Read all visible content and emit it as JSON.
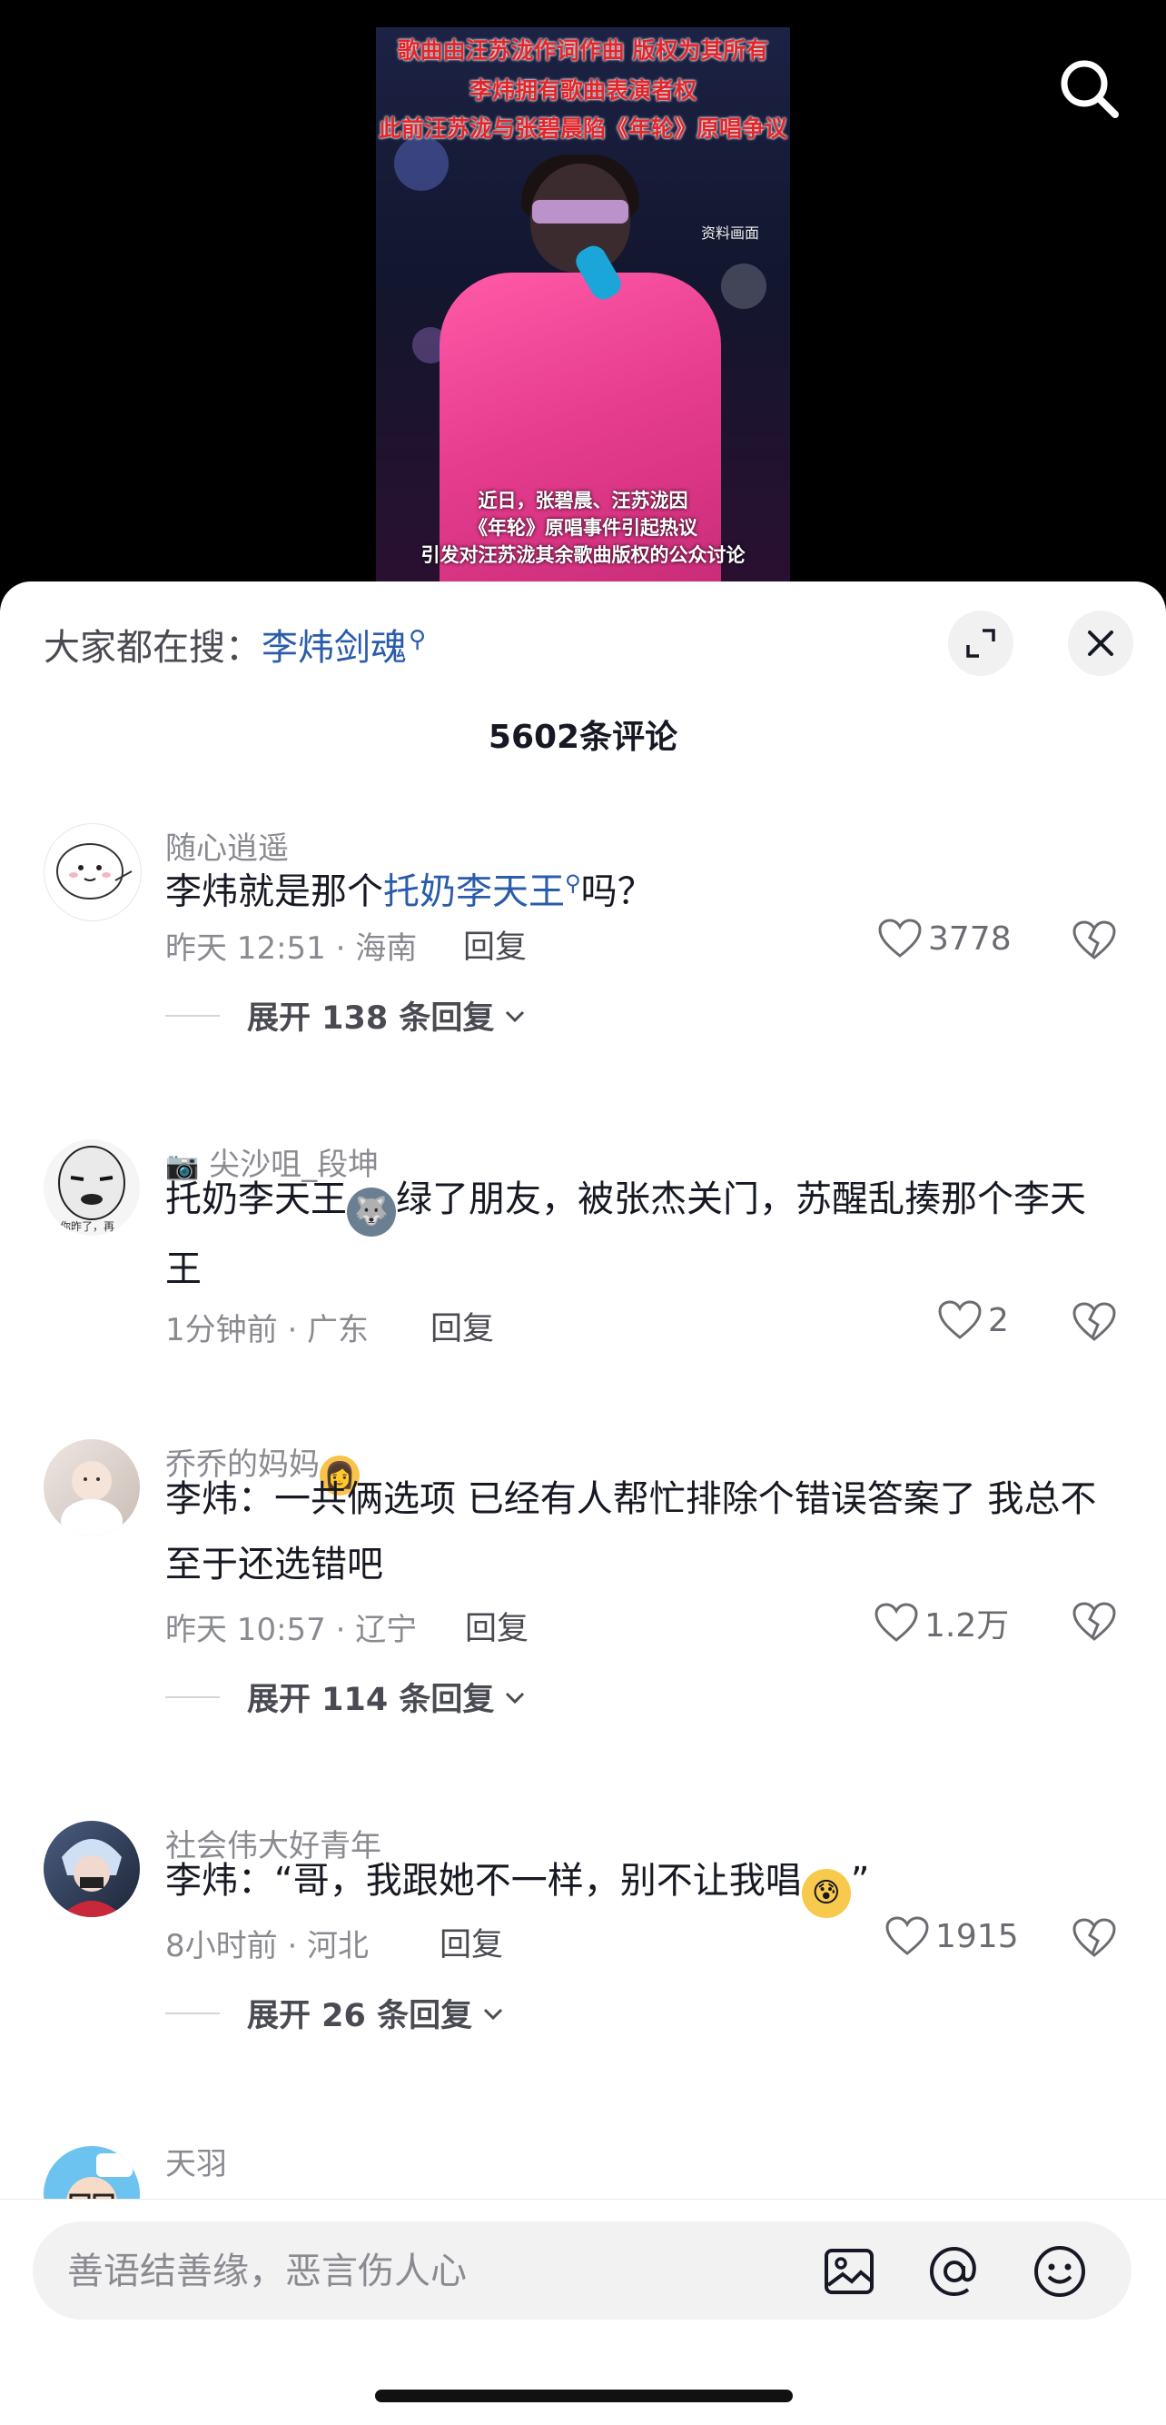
{
  "video": {
    "captions_top": [
      "歌曲由汪苏泷作词作曲 版权为其所有",
      "李炜拥有歌曲表演者权",
      "此前汪苏泷与张碧晨陷《年轮》原唱争议"
    ],
    "tag": "资料画面",
    "captions_bottom": [
      "近日，张碧晨、汪苏泷因",
      "《年轮》原唱事件引起热议",
      "引发对汪苏泷其余歌曲版权的公众讨论"
    ]
  },
  "sheet": {
    "search_prefix": "大家都在搜：",
    "search_keyword": "李炜剑魂",
    "comment_count": "5602条评论"
  },
  "comments": [
    {
      "username": "随心逍遥",
      "text_before": "李炜就是那个",
      "highlight": "托奶李天王",
      "text_after": "吗？",
      "time": "昨天 12:51 · 海南",
      "reply": "回复",
      "likes": "3778",
      "expand": "展开 138 条回复"
    },
    {
      "username": "尖沙咀_段坤",
      "text_part1": "托奶李天王",
      "text_part2": "绿了朋友，被张杰关门，苏醒乱揍那个李天王",
      "time": "1分钟前 · 广东",
      "reply": "回复",
      "likes": "2"
    },
    {
      "username": "乔乔的妈妈",
      "text": "李炜：一共俩选项 已经有人帮忙排除个错误答案了 我总不至于还选错吧",
      "time": "昨天 10:57 · 辽宁",
      "reply": "回复",
      "likes": "1.2万",
      "expand": "展开 114 条回复"
    },
    {
      "username": "社会伟大好青年",
      "text": "李炜：“哥，我跟她不一样，别不让我唱",
      "text_end": "”",
      "time": "8小时前 · 河北",
      "reply": "回复",
      "likes": "1915",
      "expand": "展开 26 条回复"
    },
    {
      "username": "天羽"
    }
  ],
  "input": {
    "placeholder": "善语结善缘，恶言伤人心"
  },
  "icons": {
    "search": "search-icon",
    "expand": "fullscreen-icon",
    "close": "close-icon",
    "like": "heart-icon",
    "dislike": "broken-heart-icon",
    "image": "image-icon",
    "mention": "at-icon",
    "emoji": "emoji-icon"
  },
  "colors": {
    "link": "#2a5caa",
    "secondary": "#8a8b91",
    "primary_text": "#161823"
  }
}
